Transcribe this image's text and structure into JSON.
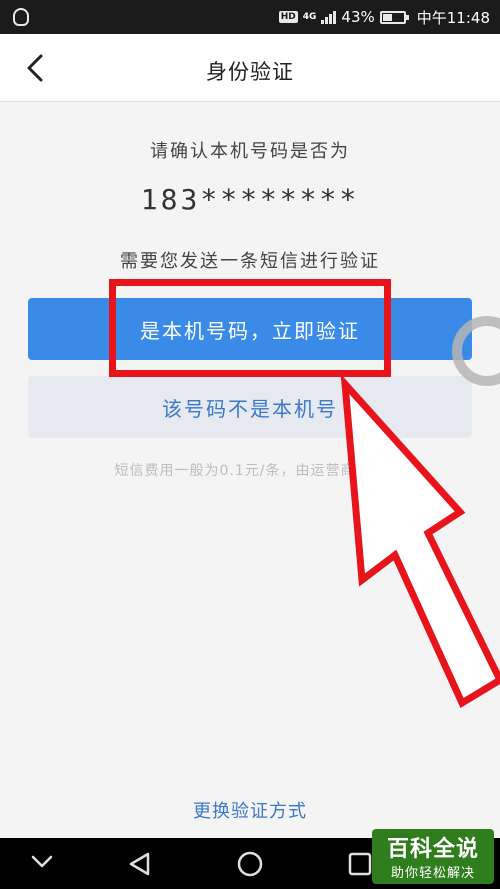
{
  "status_bar": {
    "signal_label": "4G",
    "battery_percent": "43%",
    "time": "中午11:48"
  },
  "nav": {
    "title": "身份验证"
  },
  "main": {
    "confirm_prompt": "请确认本机号码是否为",
    "phone_number": "183********",
    "sms_prompt": "需要您发送一条短信进行验证",
    "primary_button": "是本机号码，立即验证",
    "secondary_button": "该号码不是本机号",
    "fee_note": "短信费用一般为0.1元/条，由运营商收取",
    "change_method": "更换验证方式"
  },
  "watermark": {
    "main": "百科全说",
    "sub": "助你轻松解决"
  },
  "colors": {
    "accent": "#3a8be8",
    "link": "#3a78c9",
    "annotation": "#e8141c"
  },
  "icons": [
    "back-icon",
    "qq-penguin-icon",
    "nav-back-icon",
    "nav-home-icon",
    "nav-recents-icon",
    "nav-dropdown-icon"
  ]
}
